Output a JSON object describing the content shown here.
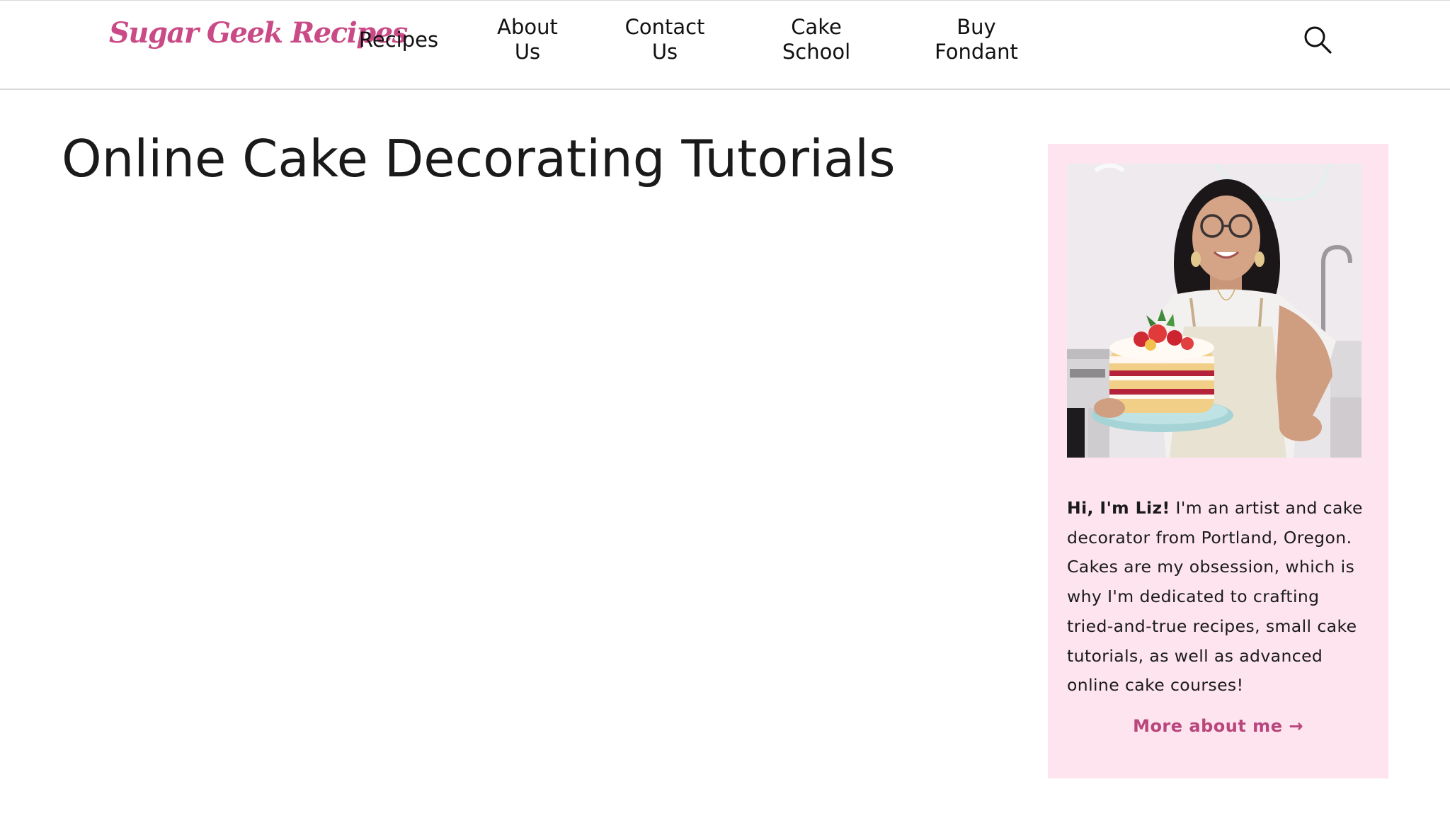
{
  "header": {
    "logo": "Sugar Geek Recipes",
    "nav": [
      {
        "label_line1": "Recipes",
        "label_line2": ""
      },
      {
        "label_line1": "About",
        "label_line2": "Us"
      },
      {
        "label_line1": "Contact",
        "label_line2": "Us"
      },
      {
        "label_line1": "Cake",
        "label_line2": "School"
      },
      {
        "label_line1": "Buy",
        "label_line2": "Fondant"
      }
    ],
    "search_icon": "search-icon"
  },
  "main": {
    "title": "Online Cake Decorating Tutorials"
  },
  "sidebar": {
    "photo_alt": "Liz holding a layered strawberry cake",
    "greeting": "Hi, I'm Liz!",
    "bio": " I'm an artist and cake decorator from Portland, Oregon. Cakes are my obsession, which is why I'm dedicated to crafting tried-and-true recipes, small cake tutorials, as well as advanced online cake courses!",
    "more_link": "More about me →"
  },
  "colors": {
    "brand_pink": "#c94a86",
    "card_background": "#fde4ef",
    "link_pink": "#b8457b"
  }
}
